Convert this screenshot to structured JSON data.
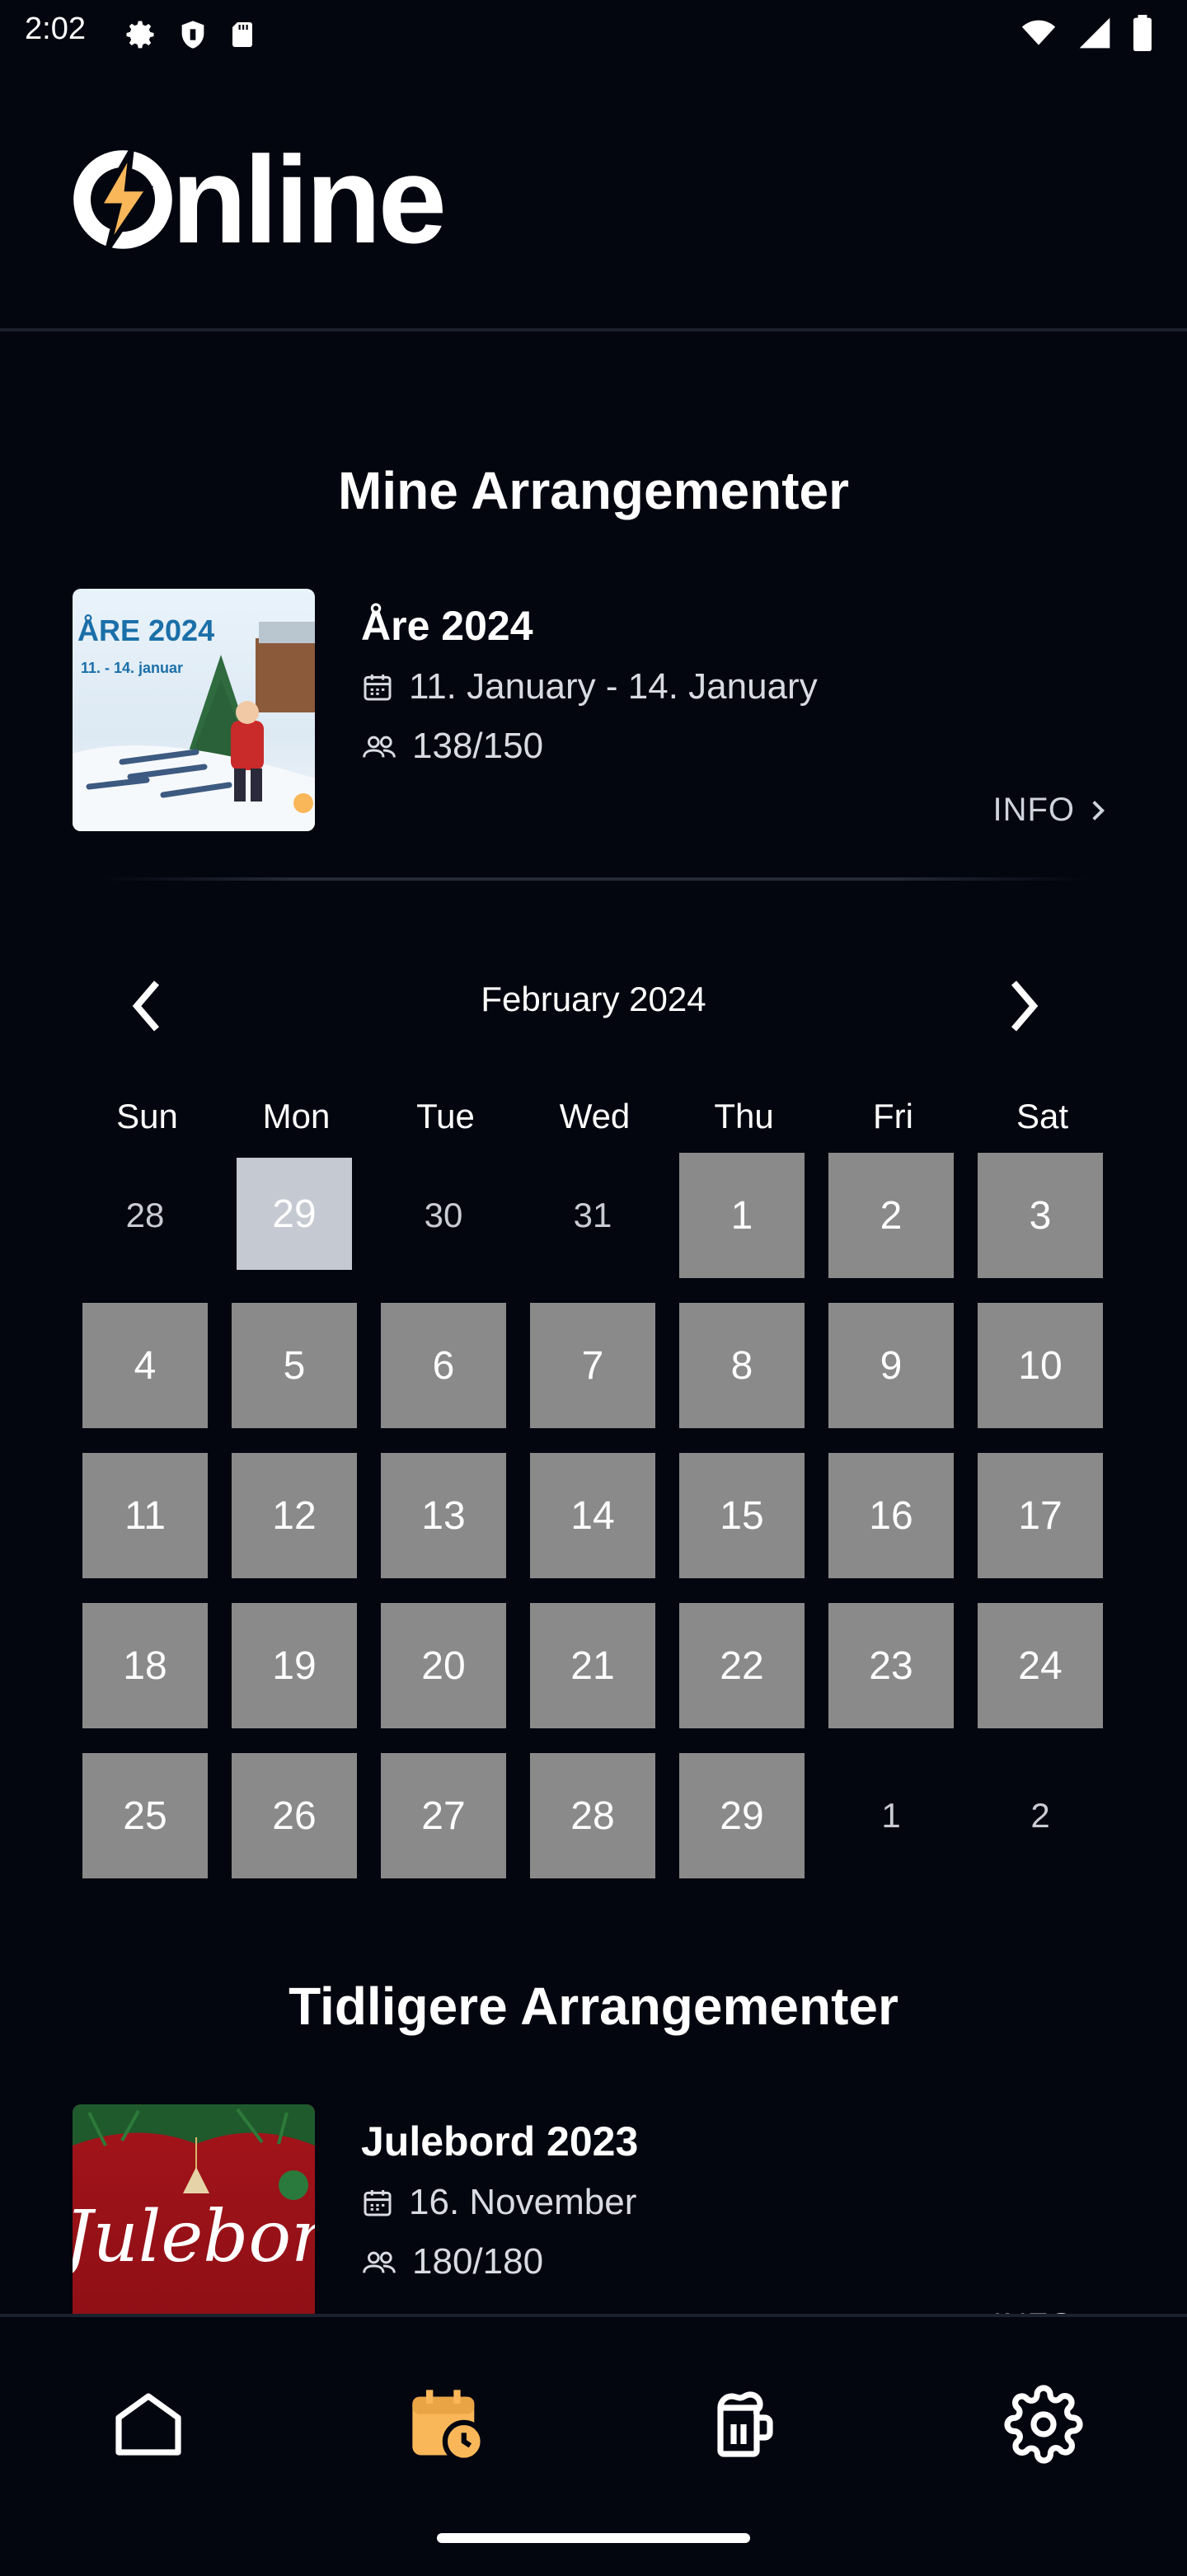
{
  "status_bar": {
    "time": "2:02"
  },
  "header": {
    "logo_text": "nline",
    "logo_icon": "lightning-o-icon"
  },
  "my_events": {
    "title": "Mine Arrangementer",
    "events": [
      {
        "name": "Åre 2024",
        "thumb_title": "ÅRE 2024",
        "thumb_dates": "11. - 14. januar",
        "date": "11. January - 14. January",
        "attendance": "138/150",
        "info_label": "INFO"
      }
    ]
  },
  "calendar": {
    "month_label": "February 2024",
    "weekdays": [
      "Sun",
      "Mon",
      "Tue",
      "Wed",
      "Thu",
      "Fri",
      "Sat"
    ],
    "days": [
      {
        "label": "28",
        "state": "muted"
      },
      {
        "label": "29",
        "state": "today"
      },
      {
        "label": "30",
        "state": "muted"
      },
      {
        "label": "31",
        "state": "muted"
      },
      {
        "label": "1",
        "state": "active"
      },
      {
        "label": "2",
        "state": "active"
      },
      {
        "label": "3",
        "state": "active"
      },
      {
        "label": "4",
        "state": "active"
      },
      {
        "label": "5",
        "state": "active"
      },
      {
        "label": "6",
        "state": "active"
      },
      {
        "label": "7",
        "state": "active"
      },
      {
        "label": "8",
        "state": "active"
      },
      {
        "label": "9",
        "state": "active"
      },
      {
        "label": "10",
        "state": "active"
      },
      {
        "label": "11",
        "state": "active"
      },
      {
        "label": "12",
        "state": "active"
      },
      {
        "label": "13",
        "state": "active"
      },
      {
        "label": "14",
        "state": "active"
      },
      {
        "label": "15",
        "state": "active"
      },
      {
        "label": "16",
        "state": "active"
      },
      {
        "label": "17",
        "state": "active"
      },
      {
        "label": "18",
        "state": "active"
      },
      {
        "label": "19",
        "state": "active"
      },
      {
        "label": "20",
        "state": "active"
      },
      {
        "label": "21",
        "state": "active"
      },
      {
        "label": "22",
        "state": "active"
      },
      {
        "label": "23",
        "state": "active"
      },
      {
        "label": "24",
        "state": "active"
      },
      {
        "label": "25",
        "state": "active"
      },
      {
        "label": "26",
        "state": "active"
      },
      {
        "label": "27",
        "state": "active"
      },
      {
        "label": "28",
        "state": "active"
      },
      {
        "label": "29",
        "state": "active"
      },
      {
        "label": "1",
        "state": "muted"
      },
      {
        "label": "2",
        "state": "muted"
      }
    ]
  },
  "previous_events": {
    "title": "Tidligere Arrangementer",
    "events": [
      {
        "name": "Julebord 2023",
        "thumb_title": "Julebord",
        "date": "16. November",
        "attendance": "180/180",
        "info_label": "INFO"
      }
    ]
  },
  "bottom_nav": {
    "items": [
      {
        "icon": "home-icon",
        "active": false
      },
      {
        "icon": "calendar-clock-icon",
        "active": true
      },
      {
        "icon": "beer-mug-icon",
        "active": false
      },
      {
        "icon": "gear-icon",
        "active": false
      }
    ],
    "active_color": "#f9b759"
  },
  "colors": {
    "background": "#03050f",
    "day_active": "#8a8a8a",
    "day_today": "#c5c9d1",
    "accent": "#f9b759"
  }
}
